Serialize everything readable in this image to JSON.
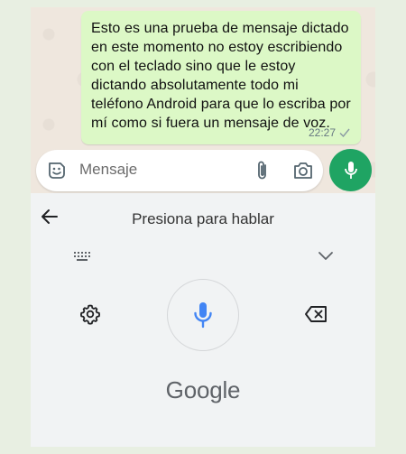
{
  "chat": {
    "message": "Esto es una prueba de mensaje dictado en este momento no estoy escribiendo con el teclado sino que le estoy dictando absolutamente todo mi teléfono Android para que lo escriba por mí como si fuera un mensaje de voz.",
    "time": "22:27"
  },
  "compose": {
    "placeholder": "Mensaje",
    "icons": [
      "emoji-icon",
      "paperclip-icon",
      "camera-icon",
      "mic-icon"
    ]
  },
  "keyboard": {
    "title": "Presiona para hablar",
    "brand": "Google",
    "icons": [
      "back-arrow-icon",
      "gear-icon",
      "mic-icon",
      "backspace-icon",
      "keyboard-grid-icon",
      "chevron-down-icon"
    ]
  },
  "colors": {
    "bubble": "#dcf8c6",
    "send_button": "#1fa463",
    "mic_blue": "#4285f4",
    "keyboard_bg": "#f1f3f4"
  }
}
